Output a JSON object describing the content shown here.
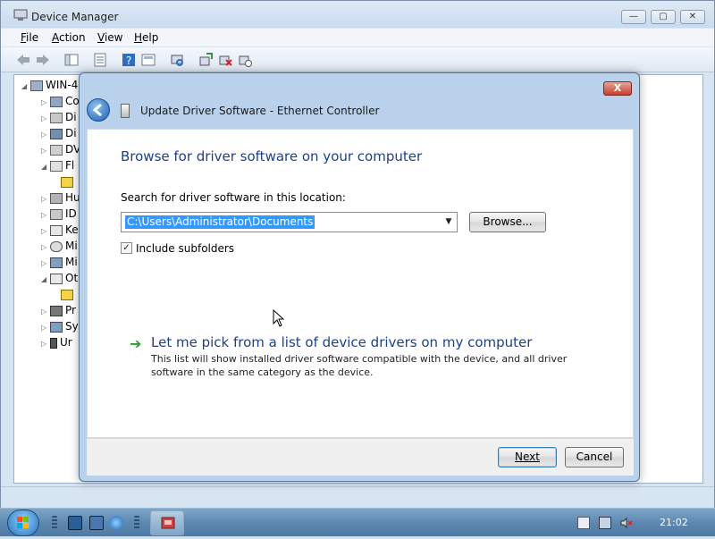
{
  "device_manager": {
    "title": "Device Manager",
    "menus": [
      {
        "key": "F",
        "rest": "ile"
      },
      {
        "key": "A",
        "rest": "ction"
      },
      {
        "key": "V",
        "rest": "iew"
      },
      {
        "key": "H",
        "rest": "elp"
      }
    ],
    "tree": {
      "root": "WIN-4",
      "items": [
        "Co",
        "Di",
        "Di",
        "DV",
        "Fl",
        "",
        "Hu",
        "ID",
        "Ke",
        "Mi",
        "Mi",
        "Ot",
        "",
        "Pr",
        "Sy",
        "Ur"
      ]
    }
  },
  "dialog": {
    "title": "Update Driver Software - Ethernet Controller",
    "close_label": "X",
    "heading": "Browse for driver software on your computer",
    "search_label": "Search for driver software in this location:",
    "path_value": "C:\\Users\\Administrator\\Documents",
    "browse_label": "Browse...",
    "include_subfolders_label": "Include subfolders",
    "include_subfolders_checked": true,
    "pick_link": "Let me pick from a list of device drivers on my computer",
    "pick_description": "This list will show installed driver software compatible with the device, and all driver software in the same category as the device.",
    "next_label": "Next",
    "cancel_label": "Cancel"
  },
  "taskbar": {
    "clock": "21:02"
  },
  "colors": {
    "heading": "#1e3f8c",
    "selection": "#3399ff",
    "link_arrow": "#2a9d2a"
  }
}
